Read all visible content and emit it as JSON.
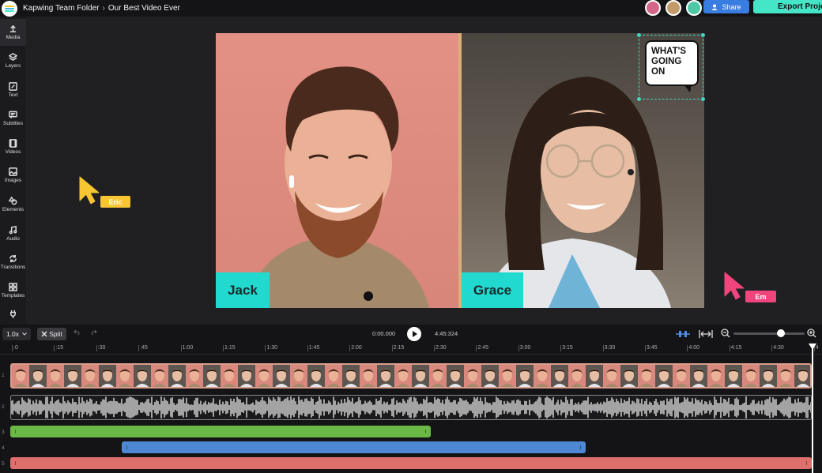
{
  "app": {
    "folder": "Kapwing Team Folder",
    "separator": "›",
    "project": "Our Best Video Ever",
    "share_label": "Share",
    "export_label": "Export Project",
    "accent": "#45e6c8",
    "share_color": "#3a7de0"
  },
  "sidebar": {
    "items": [
      {
        "label": "Media",
        "icon": "upload-icon"
      },
      {
        "label": "Layers",
        "icon": "layers-icon"
      },
      {
        "label": "Text",
        "icon": "text-edit-icon"
      },
      {
        "label": "Subtitles",
        "icon": "subtitles-icon"
      },
      {
        "label": "Videos",
        "icon": "video-icon"
      },
      {
        "label": "Images",
        "icon": "image-icon"
      },
      {
        "label": "Elements",
        "icon": "shapes-icon"
      },
      {
        "label": "Audio",
        "icon": "music-icon"
      },
      {
        "label": "Transitions",
        "icon": "transition-icon"
      },
      {
        "label": "Templates",
        "icon": "grid-icon"
      }
    ]
  },
  "canvas": {
    "left_name": "Jack",
    "right_name": "Grace",
    "sticker_text": "WHAT'S GOING ON",
    "cursors": [
      {
        "name": "Eric",
        "color": "#f8c533"
      },
      {
        "name": "Em",
        "color": "#f0447c"
      }
    ]
  },
  "timeline": {
    "speed": "1.0x",
    "split_label": "Split",
    "current_time": "0:00.000",
    "total_time": "4:45:324",
    "ruler": [
      ":0",
      ":15",
      ":30",
      ":45",
      "1:00",
      "1:15",
      "1:30",
      "1:45",
      "2:00",
      "2:15",
      "2:30",
      "2:45",
      "3:00",
      "3:15",
      "3:30",
      "3:45",
      "4:00",
      "4:15",
      "4:30",
      "4"
    ],
    "track_numbers": [
      "1",
      "2",
      "3",
      "4",
      "5"
    ],
    "clip_colors": {
      "green": "#6ab845",
      "blue": "#4e87d4",
      "red": "#dd6f6c"
    }
  }
}
